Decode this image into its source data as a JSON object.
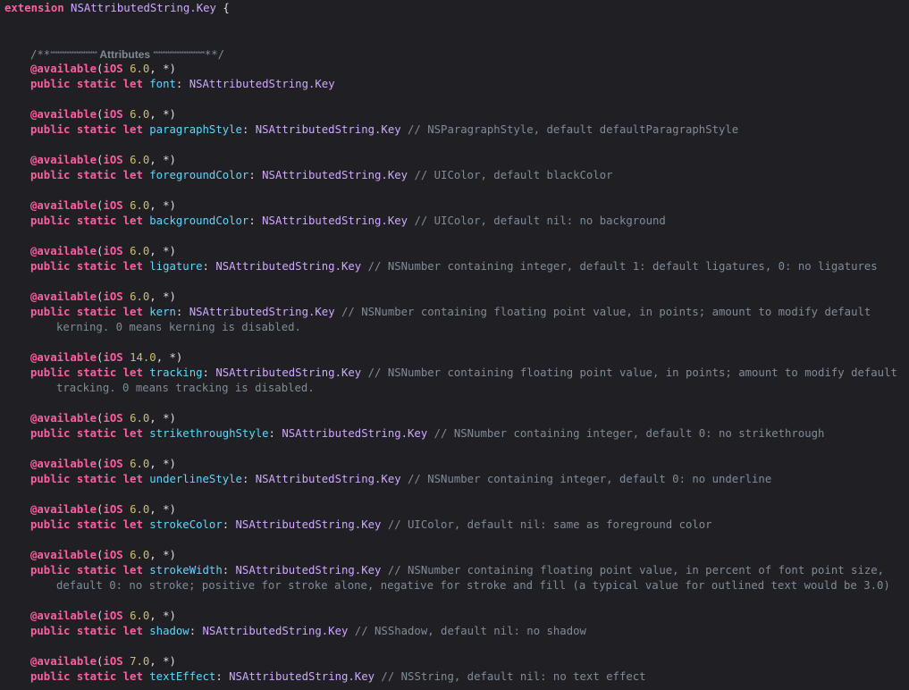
{
  "header": {
    "keyword": "extension",
    "type_name": "NSAttributedString.Key",
    "brace": "{"
  },
  "mark_comment": {
    "open": "/**",
    "stars_left": "********************",
    "label": " Attributes ",
    "stars_right": "**********************",
    "close": "**/"
  },
  "syntax": {
    "available": "@available",
    "ios": "iOS",
    "star": "*",
    "public": "public",
    "static": "static",
    "let": "let",
    "key_type": "NSAttributedString.Key",
    "comment_prefix": "//"
  },
  "attributes": [
    {
      "version": "6.0",
      "name": "font",
      "comment": "",
      "continuation": ""
    },
    {
      "version": "6.0",
      "name": "paragraphStyle",
      "comment": "NSParagraphStyle, default defaultParagraphStyle",
      "continuation": ""
    },
    {
      "version": "6.0",
      "name": "foregroundColor",
      "comment": "UIColor, default blackColor",
      "continuation": ""
    },
    {
      "version": "6.0",
      "name": "backgroundColor",
      "comment": "UIColor, default nil: no background",
      "continuation": ""
    },
    {
      "version": "6.0",
      "name": "ligature",
      "comment": "NSNumber containing integer, default 1: default ligatures, 0: no ligatures",
      "continuation": ""
    },
    {
      "version": "6.0",
      "name": "kern",
      "comment": "NSNumber containing floating point value, in points; amount to modify default",
      "continuation": "kerning. 0 means kerning is disabled."
    },
    {
      "version": "14.0",
      "name": "tracking",
      "comment": "NSNumber containing floating point value, in points; amount to modify default",
      "continuation": "tracking. 0 means tracking is disabled."
    },
    {
      "version": "6.0",
      "name": "strikethroughStyle",
      "comment": "NSNumber containing integer, default 0: no strikethrough",
      "continuation": ""
    },
    {
      "version": "6.0",
      "name": "underlineStyle",
      "comment": "NSNumber containing integer, default 0: no underline",
      "continuation": ""
    },
    {
      "version": "6.0",
      "name": "strokeColor",
      "comment": "UIColor, default nil: same as foreground color",
      "continuation": ""
    },
    {
      "version": "6.0",
      "name": "strokeWidth",
      "comment": "NSNumber containing floating point value, in percent of font point size,",
      "continuation": "default 0: no stroke; positive for stroke alone, negative for stroke and fill (a typical value for outlined text would be 3.0)"
    },
    {
      "version": "6.0",
      "name": "shadow",
      "comment": "NSShadow, default nil: no shadow",
      "continuation": ""
    },
    {
      "version": "7.0",
      "name": "textEffect",
      "comment": "NSString, default nil: no text effect",
      "continuation": ""
    }
  ],
  "colors": {
    "background": "#1f1f24",
    "keyword": "#fc5fa3",
    "type": "#d0a8ff",
    "identifier": "#5dd8ff",
    "number": "#d0bf69",
    "comment": "#7f8c98",
    "plain": "#dfdfe0"
  }
}
